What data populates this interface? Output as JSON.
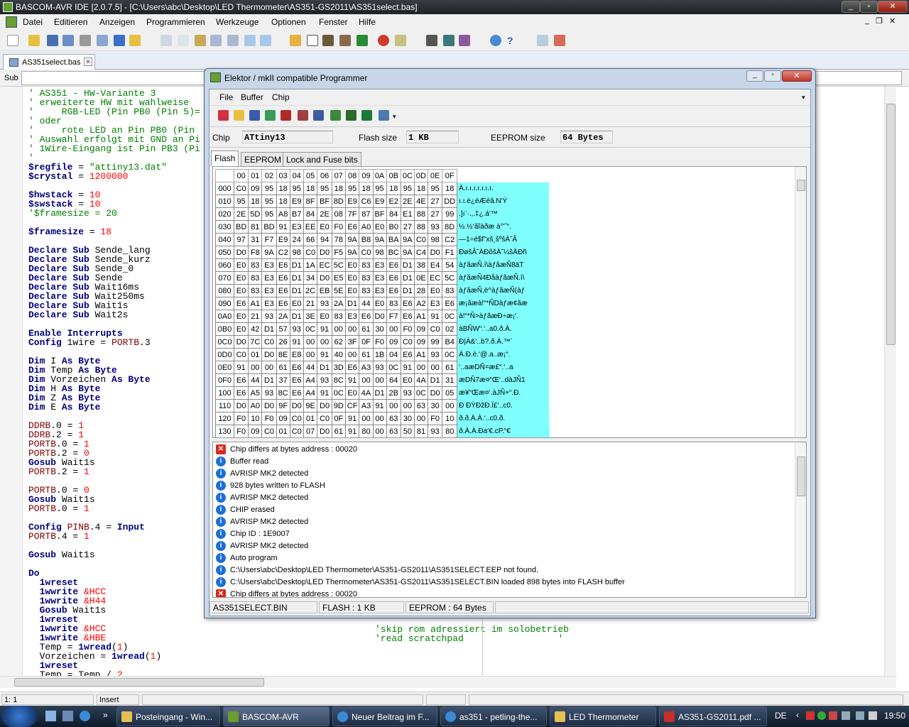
{
  "window": {
    "title": "BASCOM-AVR IDE [2.0.7.5] - [C:\\Users\\abc\\Desktop\\LED Thermometer\\AS351-GS2011\\AS351select.bas]"
  },
  "menu": [
    "Datei",
    "Editieren",
    "Anzeigen",
    "Programmieren",
    "Werkzeuge",
    "Optionen",
    "Fenster",
    "Hilfe"
  ],
  "doc_tab": "AS351select.bas",
  "sub_label": "Sub",
  "statusbar": {
    "pos": "1: 1",
    "mode": "Insert"
  },
  "code_bottom_comments": [
    "'skip rom adressiert im solobetrieb",
    "'read scratchpad                 '"
  ],
  "programmer": {
    "title": "Elektor / mkII compatible Programmer",
    "menu": [
      "File",
      "Buffer",
      "Chip"
    ],
    "chip_label": "Chip",
    "chip_value": "ATtiny13",
    "flash_label": "Flash size",
    "flash_value": "1 KB",
    "eeprom_label": "EEPROM size",
    "eeprom_value": "64 Bytes",
    "tabs": [
      "Flash",
      "EEPROM",
      "Lock and Fuse bits"
    ],
    "hex_header": [
      "00",
      "01",
      "02",
      "03",
      "04",
      "05",
      "06",
      "07",
      "08",
      "09",
      "0A",
      "0B",
      "0C",
      "0D",
      "0E",
      "0F"
    ],
    "hex_rows": [
      {
        "addr": "000",
        "bytes": [
          "C0",
          "09",
          "95",
          "18",
          "95",
          "18",
          "95",
          "18",
          "95",
          "18",
          "95",
          "18",
          "95",
          "18",
          "95",
          "18"
        ],
        "ascii": "À.ı.ı.ı.ı.ı.ı.ı."
      },
      {
        "addr": "010",
        "bytes": [
          "95",
          "18",
          "95",
          "18",
          "E9",
          "8F",
          "BF",
          "8D",
          "E9",
          "C6",
          "E9",
          "E2",
          "2E",
          "4E",
          "27",
          "DD"
        ],
        "ascii": "ı.ı.é¿éÆéâ.N'Ý"
      },
      {
        "addr": "020",
        "bytes": [
          "2E",
          "5D",
          "95",
          "A8",
          "B7",
          "84",
          "2E",
          "08",
          "7F",
          "87",
          "BF",
          "84",
          "E1",
          "88",
          "27",
          "99"
        ],
        "ascii": ".]ı¨·.‚.‡¿.á'™"
      },
      {
        "addr": "030",
        "bytes": [
          "BD",
          "81",
          "BD",
          "91",
          "E3",
          "EE",
          "E0",
          "F0",
          "E6",
          "A0",
          "E0",
          "B0",
          "27",
          "88",
          "93",
          "8D"
        ],
        "ascii": "½.½‘ãîàðæ à°'ˆ“."
      },
      {
        "addr": "040",
        "bytes": [
          "97",
          "31",
          "F7",
          "E9",
          "24",
          "66",
          "94",
          "78",
          "9A",
          "B8",
          "9A",
          "BA",
          "9A",
          "C0",
          "98",
          "C2"
        ],
        "ascii": "—1÷é$f”xš¸šºšÀ˜Â"
      },
      {
        "addr": "050",
        "bytes": [
          "D0",
          "F8",
          "9A",
          "C2",
          "98",
          "C0",
          "D0",
          "F5",
          "9A",
          "C0",
          "98",
          "BC",
          "9A",
          "C4",
          "D0",
          "F1"
        ],
        "ascii": "ÐøšÂ˜ÀÐõšÀ˜¼šÄÐñ"
      },
      {
        "addr": "060",
        "bytes": [
          "E0",
          "83",
          "E3",
          "E6",
          "D1",
          "1A",
          "EC",
          "5C",
          "E0",
          "83",
          "E3",
          "E6",
          "D1",
          "38",
          "E4",
          "54"
        ],
        "ascii": "àƒãæÑ.ì\\àƒãæÑ8äT"
      },
      {
        "addr": "070",
        "bytes": [
          "E0",
          "83",
          "E3",
          "E6",
          "D1",
          "34",
          "D0",
          "E5",
          "E0",
          "83",
          "E3",
          "E6",
          "D1",
          "0E",
          "EC",
          "5C"
        ],
        "ascii": "àƒãæÑ4ÐåàƒãæÑ.ì\\"
      },
      {
        "addr": "080",
        "bytes": [
          "E0",
          "83",
          "E3",
          "E6",
          "D1",
          "2C",
          "EB",
          "5E",
          "E0",
          "83",
          "E3",
          "E6",
          "D1",
          "28",
          "E0",
          "83"
        ],
        "ascii": "àƒãæÑ,ë^àƒãæÑ(àƒ"
      },
      {
        "addr": "090",
        "bytes": [
          "E6",
          "A1",
          "E3",
          "E6",
          "E0",
          "21",
          "93",
          "2A",
          "D1",
          "44",
          "E0",
          "83",
          "E6",
          "A2",
          "E3",
          "E6"
        ],
        "ascii": "æ¡ãæà!“*ÑDàƒæ¢ãæ"
      },
      {
        "addr": "0A0",
        "bytes": [
          "E0",
          "21",
          "93",
          "2A",
          "D1",
          "3E",
          "E0",
          "83",
          "E3",
          "E6",
          "D0",
          "F7",
          "E6",
          "A1",
          "91",
          "0C"
        ],
        "ascii": "à!“*Ñ>àƒãæÐ÷æ¡‘."
      },
      {
        "addr": "0B0",
        "bytes": [
          "E0",
          "42",
          "D1",
          "57",
          "93",
          "0C",
          "91",
          "00",
          "00",
          "61",
          "30",
          "00",
          "F0",
          "09",
          "C0",
          "02"
        ],
        "ascii": "àBÑW“.‘..a0.ð.À."
      },
      {
        "addr": "0C0",
        "bytes": [
          "D0",
          "7C",
          "C0",
          "26",
          "91",
          "00",
          "00",
          "62",
          "3F",
          "0F",
          "F0",
          "09",
          "C0",
          "09",
          "99",
          "B4"
        ],
        "ascii": "Ð|À&‘..b?.ð.À.™´"
      },
      {
        "addr": "0D0",
        "bytes": [
          "C0",
          "01",
          "D0",
          "8E",
          "E8",
          "00",
          "91",
          "40",
          "00",
          "61",
          "1B",
          "04",
          "E6",
          "A1",
          "93",
          "0C"
        ],
        "ascii": "À.Ð.è.‘@.a..æ¡“."
      },
      {
        "addr": "0E0",
        "bytes": [
          "91",
          "00",
          "00",
          "61",
          "E6",
          "44",
          "D1",
          "3D",
          "E6",
          "A3",
          "93",
          "0C",
          "91",
          "00",
          "00",
          "61"
        ],
        "ascii": "‘..aæDÑ=æ£“.‘..a"
      },
      {
        "addr": "0F0",
        "bytes": [
          "E6",
          "44",
          "D1",
          "37",
          "E6",
          "A4",
          "93",
          "8C",
          "91",
          "00",
          "00",
          "64",
          "E0",
          "4A",
          "D1",
          "31"
        ],
        "ascii": "æDÑ7æ¤“Œ‘..dàJÑ1"
      },
      {
        "addr": "100",
        "bytes": [
          "E6",
          "A5",
          "93",
          "8C",
          "E6",
          "A4",
          "91",
          "0C",
          "E0",
          "4A",
          "D1",
          "2B",
          "93",
          "0C",
          "D0",
          "05"
        ],
        "ascii": "æ¥“Œæ¤‘.àJÑ+“.Ð."
      },
      {
        "addr": "110",
        "bytes": [
          "D0",
          "A0",
          "D0",
          "9F",
          "D0",
          "9E",
          "D0",
          "9D",
          "CF",
          "A3",
          "91",
          "00",
          "00",
          "63",
          "30",
          "00"
        ],
        "ascii": "Ð ÐŸÐžÐ.Ï£‘..c0."
      },
      {
        "addr": "120",
        "bytes": [
          "F0",
          "10",
          "F0",
          "09",
          "C0",
          "01",
          "C0",
          "0F",
          "91",
          "00",
          "00",
          "63",
          "30",
          "00",
          "F0",
          "10"
        ],
        "ascii": "ð.ð.À.À.‘..c0.ð."
      },
      {
        "addr": "130",
        "bytes": [
          "F0",
          "09",
          "C0",
          "01",
          "C0",
          "07",
          "D0",
          "61",
          "91",
          "80",
          "00",
          "63",
          "50",
          "81",
          "93",
          "80"
        ],
        "ascii": "ð.À.À.Ða‘€.cP.“€"
      }
    ],
    "log": [
      {
        "type": "err",
        "text": "Chip differs at bytes address : 00020"
      },
      {
        "type": "info",
        "text": "Buffer read"
      },
      {
        "type": "info",
        "text": "AVRISP MK2 detected"
      },
      {
        "type": "info",
        "text": "928 bytes written to FLASH"
      },
      {
        "type": "info",
        "text": "AVRISP MK2 detected"
      },
      {
        "type": "info",
        "text": "CHIP erased"
      },
      {
        "type": "info",
        "text": "AVRISP MK2 detected"
      },
      {
        "type": "info",
        "text": "Chip ID : 1E9007"
      },
      {
        "type": "info",
        "text": "AVRISP MK2 detected"
      },
      {
        "type": "info",
        "text": "Auto program"
      },
      {
        "type": "info",
        "text": "C:\\Users\\abc\\Desktop\\LED Thermometer\\AS351-GS2011\\AS351SELECT.EEP not found."
      },
      {
        "type": "info",
        "text": "C:\\Users\\abc\\Desktop\\LED Thermometer\\AS351-GS2011\\AS351SELECT.BIN loaded 898 bytes into FLASH buffer"
      },
      {
        "type": "err",
        "text": "Chip differs at bytes address : 00020"
      }
    ],
    "status": {
      "file": "AS351SELECT.BIN",
      "flash": "FLASH : 1 KB",
      "eeprom": "EEPROM : 64 Bytes"
    }
  },
  "taskbar": {
    "tasks": [
      "Posteingang - Win...",
      "BASCOM-AVR",
      "Neuer Beitrag im F...",
      "as351 - petling-the...",
      "LED Thermometer",
      "AS351-GS2011.pdf ..."
    ],
    "lang": "DE",
    "clock": "19:50"
  }
}
